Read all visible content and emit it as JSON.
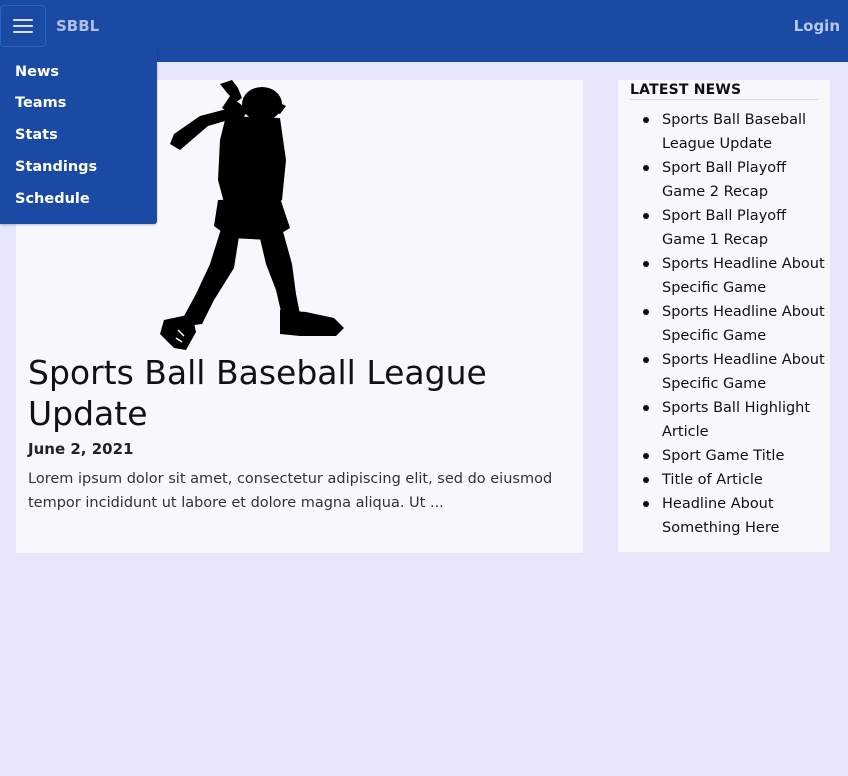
{
  "navbar": {
    "brand": "SBBL",
    "login": "Login",
    "menu_items": [
      "News",
      "Teams",
      "Stats",
      "Standings",
      "Schedule"
    ]
  },
  "article": {
    "title": "Sports Ball Baseball League Update",
    "date": "June 2, 2021",
    "excerpt": "Lorem ipsum dolor sit amet, consectetur adipiscing elit, sed do eiusmod tempor incididunt ut labore et dolore magna aliqua. Ut ..."
  },
  "sidebar": {
    "title": "LATEST NEWS",
    "items": [
      "Sports Ball Baseball League Update",
      "Sport Ball Playoff Game 2 Recap",
      "Sport Ball Playoff Game 1 Recap",
      "Sports Headline About Specific Game",
      "Sports Headline About Specific Game",
      "Sports Headline About Specific Game",
      "Sports Ball Highlight Article",
      "Sport Game Title",
      "Title of Article",
      "Headline About Something Here"
    ]
  },
  "colors": {
    "navbar": "#1a4aa3",
    "page_background": "#e6e6fa",
    "card_background": "#f6f8fb"
  }
}
